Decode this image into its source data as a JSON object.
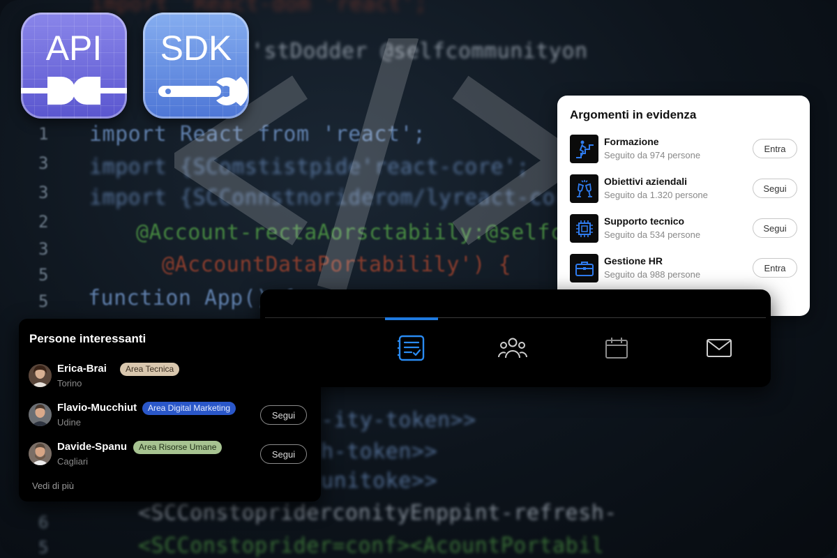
{
  "code_background": {
    "line_numbers": [
      "1",
      "3",
      "3",
      "2",
      "3",
      "5",
      "5",
      "6",
      "5"
    ],
    "lines": [
      "import 'React-dom  'react';",
      "'stDodder @selfcommunityon",
      "import React from 'react';",
      "import {SComstistpide'react-core';",
      "import {SCConnstnoriderom/lyreact-core};",
      "@Account-rectaAorsctabiily:@selfcom",
      "@AccountDataPortabilily') {",
      "function App() {",
      "-ity-token>>",
      "h-token>>",
      "unitoke>>",
      "<SCConstopriderconityEnppint-refresh-",
      "<SCConstoprider=conf><AcountPortabil"
    ]
  },
  "app_icons": [
    {
      "label": "API",
      "icon": "plug-icon"
    },
    {
      "label": "SDK",
      "icon": "wrench-icon"
    }
  ],
  "topics_card": {
    "title": "Argomenti in evidenza",
    "items": [
      {
        "name": "Formazione",
        "followers": "Seguito da 974 persone",
        "action": "Entra",
        "icon": "stairs-climb-icon"
      },
      {
        "name": "Obiettivi aziendali",
        "followers": "Seguito da 1.320 persone",
        "action": "Segui",
        "icon": "toast-glasses-icon"
      },
      {
        "name": "Supporto tecnico",
        "followers": "Seguito da 534 persone",
        "action": "Segui",
        "icon": "chip-icon"
      },
      {
        "name": "Gestione HR",
        "followers": "Seguito da 988 persone",
        "action": "Entra",
        "icon": "briefcase-icon"
      }
    ]
  },
  "nav_bar": {
    "items": [
      "home-icon",
      "feed-icon",
      "groups-icon",
      "calendar-icon",
      "mail-icon"
    ],
    "active": "feed-icon",
    "accent": "#1f7ae0"
  },
  "people_card": {
    "title": "Persone interessanti",
    "people": [
      {
        "name": "Erica-Brai",
        "tag": "Area Tecnica",
        "city": "Torino",
        "action": "",
        "tag_color": "#d9c7ae"
      },
      {
        "name": "Flavio-Mucchiut",
        "tag": "Area Digital Marketing",
        "city": "Udine",
        "action": "Segui",
        "tag_color": "#2a57c9"
      },
      {
        "name": "Davide-Spanu",
        "tag": "Area Risorse Umane",
        "city": "Cagliari",
        "action": "Segui",
        "tag_color": "#a7c391"
      }
    ],
    "more_link": "Vedi di più"
  }
}
